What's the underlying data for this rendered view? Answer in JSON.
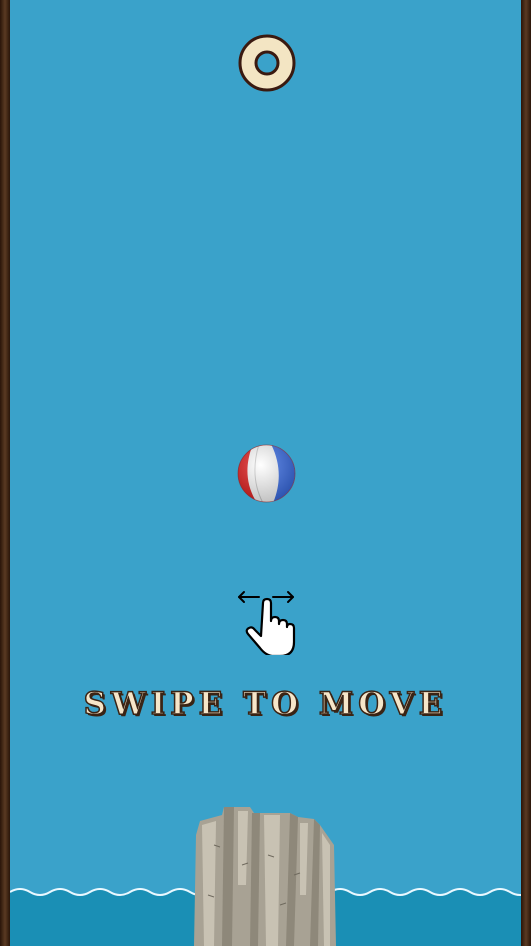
{
  "game": {
    "instruction": "SWIPE TO MOVE"
  },
  "icons": {
    "ring": "ring-hoop-icon",
    "ball": "beach-ball-icon",
    "hint": "swipe-hand-icon"
  },
  "colors": {
    "sky": "#3aa2ca",
    "water": "#1a8fb5",
    "text": "#f6e6c9",
    "outline": "#3a2415",
    "ball_red": "#e31b1b",
    "ball_blue": "#3a6ee8"
  }
}
